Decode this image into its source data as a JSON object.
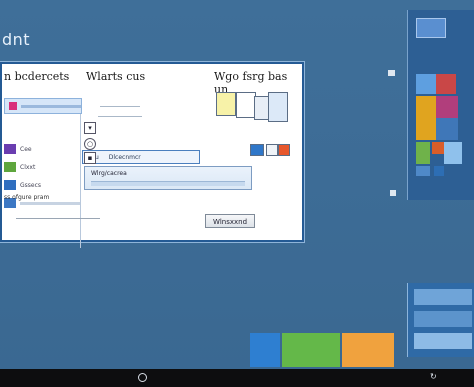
{
  "desktop": {
    "title": "dnt"
  },
  "dialog": {
    "heading_left": "n bcdercets",
    "heading_mid": "Wlarts cus",
    "heading_right": "Wgo fsrg bas un",
    "search_label": "Gcu",
    "search_text": "Dlcecnmcr",
    "list_items": [
      "Cee",
      "Clxxt",
      "Gssecs"
    ],
    "field_label": "Wlrg/cacrea",
    "footer_text": "ss ofgure pram",
    "install_button": "Wlnsxxnd"
  },
  "colors": {
    "desktop": "#3d6c96",
    "dialog_border": "#245a94",
    "taskbar": "#0d0d0f"
  },
  "icons": [
    "windows-logo-icon",
    "search-icon",
    "power-icon",
    "file-icon",
    "edge-icon",
    "folder-icon"
  ]
}
